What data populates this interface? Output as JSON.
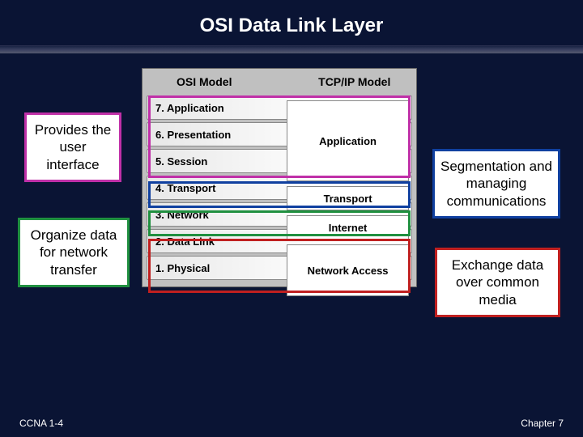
{
  "title": "OSI Data Link Layer",
  "callouts": {
    "top_left": "Provides the user interface",
    "bottom_left": "Organize data for network transfer",
    "top_right": "Segmentation and managing communications",
    "bottom_right": "Exchange data over common media"
  },
  "diagram": {
    "headers": {
      "left": "OSI Model",
      "right": "TCP/IP Model"
    },
    "osi_layers": [
      "7. Application",
      "6. Presentation",
      "5. Session",
      "4. Transport",
      "3. Network",
      "2. Data Link",
      "1. Physical"
    ],
    "tcp_layers": [
      "Application",
      "Transport",
      "Internet",
      "Network Access"
    ]
  },
  "footer": {
    "left": "CCNA 1-4",
    "right": "Chapter 7"
  },
  "colors": {
    "background": "#0a1434",
    "purple": "#c030a8",
    "blue": "#1040a0",
    "green": "#209040",
    "red": "#c02020"
  }
}
